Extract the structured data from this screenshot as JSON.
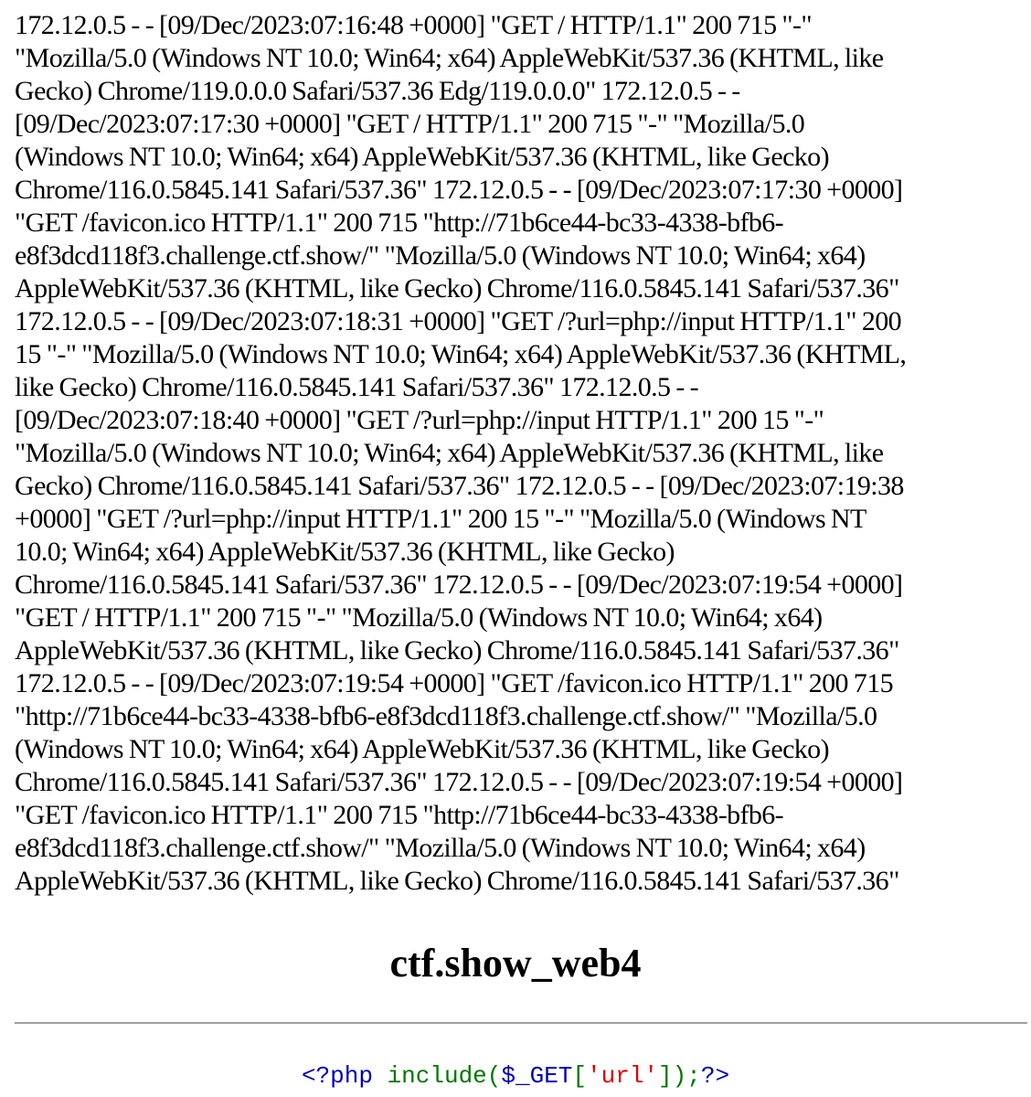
{
  "log": {
    "lines": [
      "172.12.0.5 - - [09/Dec/2023:07:16:48 +0000] \"GET / HTTP/1.1\" 200 715 \"-\"",
      "\"Mozilla/5.0 (Windows NT 10.0; Win64; x64) AppleWebKit/537.36 (KHTML, like",
      "Gecko) Chrome/119.0.0.0 Safari/537.36 Edg/119.0.0.0\" 172.12.0.5 - -",
      "[09/Dec/2023:07:17:30 +0000] \"GET / HTTP/1.1\" 200 715 \"-\" \"Mozilla/5.0",
      "(Windows NT 10.0; Win64; x64) AppleWebKit/537.36 (KHTML, like Gecko)",
      "Chrome/116.0.5845.141 Safari/537.36\" 172.12.0.5 - - [09/Dec/2023:07:17:30 +0000]",
      "\"GET /favicon.ico HTTP/1.1\" 200 715 \"http://71b6ce44-bc33-4338-bfb6-",
      "e8f3dcd118f3.challenge.ctf.show/\" \"Mozilla/5.0 (Windows NT 10.0; Win64; x64)",
      "AppleWebKit/537.36 (KHTML, like Gecko) Chrome/116.0.5845.141 Safari/537.36\"",
      "172.12.0.5 - - [09/Dec/2023:07:18:31 +0000] \"GET /?url=php://input HTTP/1.1\" 200",
      "15 \"-\" \"Mozilla/5.0 (Windows NT 10.0; Win64; x64) AppleWebKit/537.36 (KHTML,",
      "like Gecko) Chrome/116.0.5845.141 Safari/537.36\" 172.12.0.5 - -",
      "[09/Dec/2023:07:18:40 +0000] \"GET /?url=php://input HTTP/1.1\" 200 15 \"-\"",
      "\"Mozilla/5.0 (Windows NT 10.0; Win64; x64) AppleWebKit/537.36 (KHTML, like",
      "Gecko) Chrome/116.0.5845.141 Safari/537.36\" 172.12.0.5 - - [09/Dec/2023:07:19:38",
      "+0000] \"GET /?url=php://input HTTP/1.1\" 200 15 \"-\" \"Mozilla/5.0 (Windows NT",
      "10.0; Win64; x64) AppleWebKit/537.36 (KHTML, like Gecko)",
      "Chrome/116.0.5845.141 Safari/537.36\" 172.12.0.5 - - [09/Dec/2023:07:19:54 +0000]",
      "\"GET / HTTP/1.1\" 200 715 \"-\" \"Mozilla/5.0 (Windows NT 10.0; Win64; x64)",
      "AppleWebKit/537.36 (KHTML, like Gecko) Chrome/116.0.5845.141 Safari/537.36\"",
      "172.12.0.5 - - [09/Dec/2023:07:19:54 +0000] \"GET /favicon.ico HTTP/1.1\" 200 715",
      "\"http://71b6ce44-bc33-4338-bfb6-e8f3dcd118f3.challenge.ctf.show/\" \"Mozilla/5.0",
      "(Windows NT 10.0; Win64; x64) AppleWebKit/537.36 (KHTML, like Gecko)",
      "Chrome/116.0.5845.141 Safari/537.36\" 172.12.0.5 - - [09/Dec/2023:07:19:54 +0000]",
      "\"GET /favicon.ico HTTP/1.1\" 200 715 \"http://71b6ce44-bc33-4338-bfb6-",
      "e8f3dcd118f3.challenge.ctf.show/\" \"Mozilla/5.0 (Windows NT 10.0; Win64; x64)",
      "AppleWebKit/537.36 (KHTML, like Gecko) Chrome/116.0.5845.141 Safari/537.36\""
    ]
  },
  "title": "ctf.show_web4",
  "source": {
    "open_tag": "<?php ",
    "keyword": "include",
    "open_paren": "(",
    "variable": "$_GET",
    "open_bracket": "[",
    "string": "'url'",
    "close_bracket_paren": "]);",
    "close_tag": "?>"
  },
  "colors": {
    "php_tag": "#0000bb",
    "php_keyword": "#007700",
    "php_string": "#dd0000",
    "divider": "#a0a0a0"
  }
}
